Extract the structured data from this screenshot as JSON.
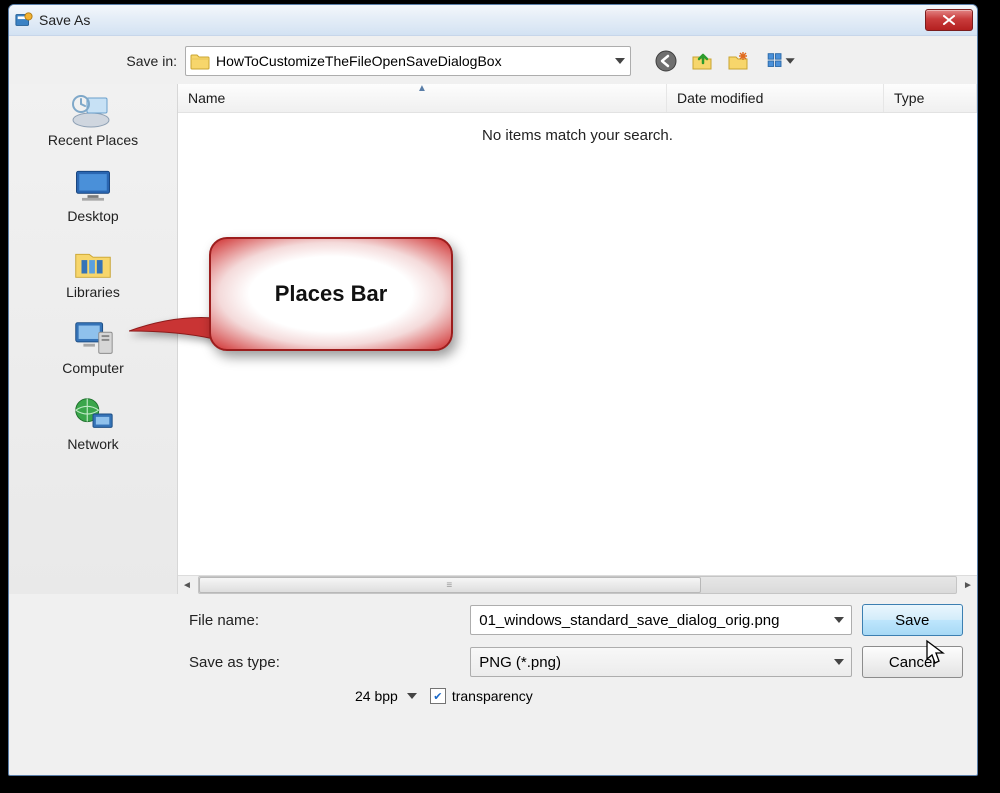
{
  "titlebar": {
    "title": "Save As"
  },
  "savein": {
    "label": "Save in:",
    "folder": "HowToCustomizeTheFileOpenSaveDialogBox"
  },
  "places": {
    "items": [
      {
        "label": "Recent Places"
      },
      {
        "label": "Desktop"
      },
      {
        "label": "Libraries"
      },
      {
        "label": "Computer"
      },
      {
        "label": "Network"
      }
    ]
  },
  "columns": {
    "name": "Name",
    "date": "Date modified",
    "type": "Type"
  },
  "empty_message": "No items match your search.",
  "callout": {
    "text": "Places Bar"
  },
  "form": {
    "filename_label": "File name:",
    "filename_value": "01_windows_standard_save_dialog_orig.png",
    "savetype_label": "Save as type:",
    "savetype_value": "PNG (*.png)",
    "save_label": "Save",
    "cancel_label": "Cancel",
    "bpp_label": "24 bpp",
    "transparency_label": "transparency",
    "transparency_checked": true
  }
}
